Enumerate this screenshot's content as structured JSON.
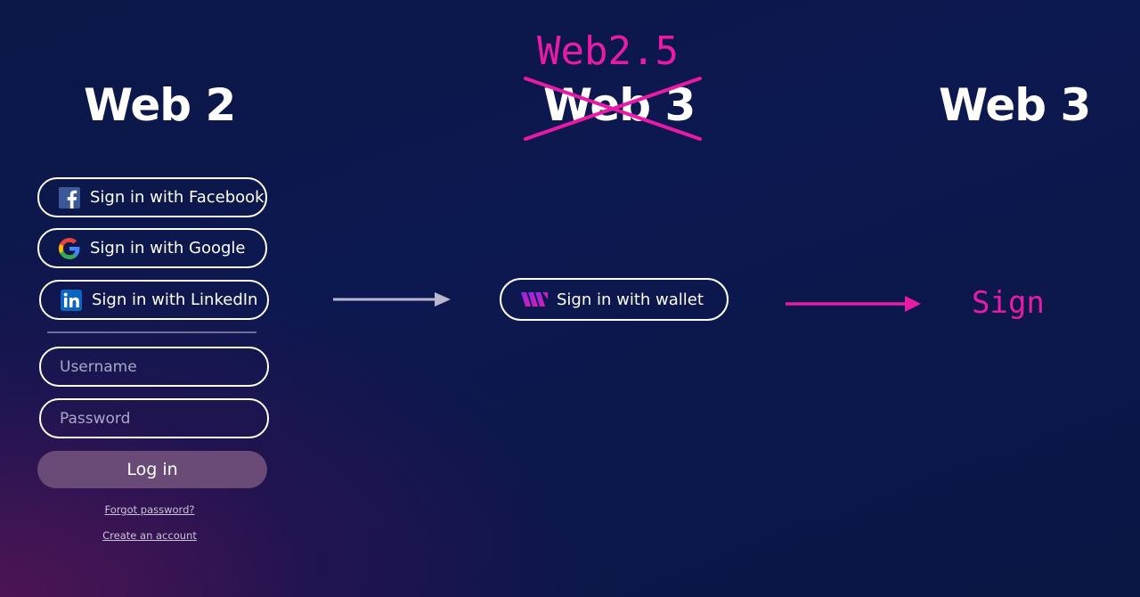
{
  "headings": {
    "web2": "Web 2",
    "web3_crossed": "Web 3",
    "web25": "Web2.5",
    "web3_final": "Web 3"
  },
  "web2_panel": {
    "facebook_label": "Sign in with Facebook",
    "google_label": "Sign in with Google",
    "linkedin_label": "Sign in with LinkedIn",
    "username_placeholder": "Username",
    "password_placeholder": "Password",
    "login_label": "Log in",
    "forgot_label": "Forgot password?",
    "create_label": "Create an account"
  },
  "wallet": {
    "label": "Sign in with wallet"
  },
  "sign": {
    "label": "Sign"
  },
  "colors": {
    "accent_pink": "#e81aa6",
    "arrow_grey": "#b6b8cc",
    "login_button": "#6a4a77",
    "facebook_blue": "#3b5998",
    "linkedin_blue": "#0a66c2"
  },
  "icons": {
    "facebook": "facebook-icon",
    "google": "google-icon",
    "linkedin": "linkedin-icon",
    "wallet": "wallet-logo-icon"
  }
}
